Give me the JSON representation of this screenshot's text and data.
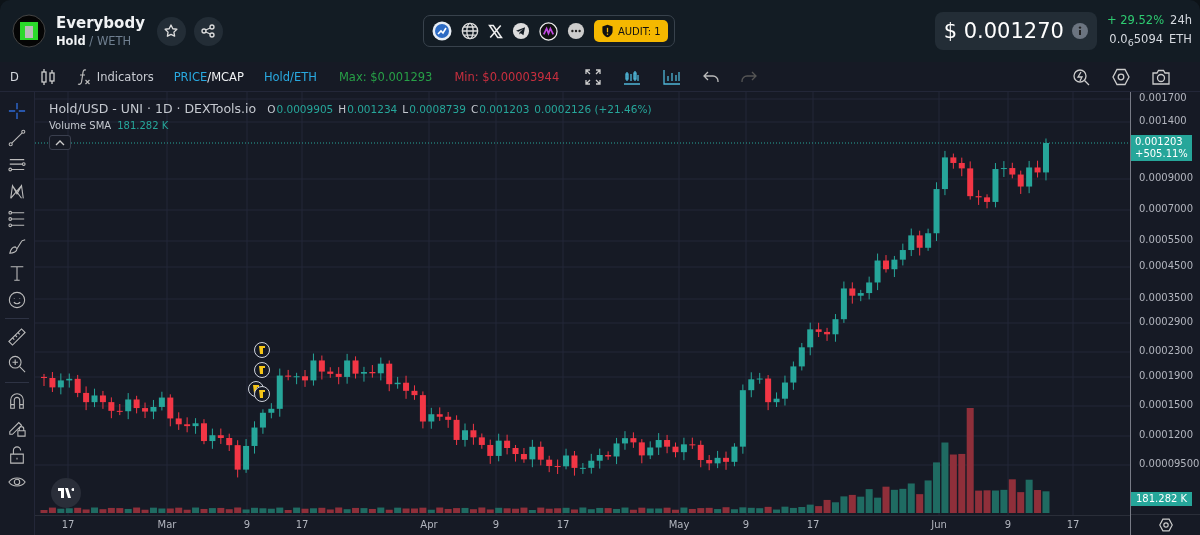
{
  "token": {
    "name": "Everybody",
    "base": "Hold",
    "quote": "/ WETH"
  },
  "audit": "AUDIT: 1",
  "price": {
    "value": "$ 0.001270",
    "change": "+ 29.52%",
    "period": "24h",
    "eth_value": "0.0$_{6}$5094",
    "eth_unit": "ETH"
  },
  "toolbar": {
    "interval": "D",
    "indicators": "Indicators",
    "modes": [
      {
        "label": "PRICE",
        "selected": true
      },
      {
        "label": "/MCAP",
        "selected": false
      }
    ],
    "pair": "Hold/ETH",
    "max": "Max: $0.001293",
    "min": "Min: $0.00003944"
  },
  "legend": {
    "title": "Hold/USD - UNI · 1D · DEXTools.io",
    "ohlc": [
      {
        "key": "O",
        "value": "0.0009905"
      },
      {
        "key": "H",
        "value": "0.001234"
      },
      {
        "key": "L",
        "value": "0.0008739"
      },
      {
        "key": "C",
        "value": "0.001203"
      }
    ],
    "change": "0.0002126 (+21.46%)",
    "volume_label": "Volume SMA",
    "volume_value": "181.282 K"
  },
  "price_axis": {
    "ticks": [
      "0.001700",
      "0.001400",
      "0.0009000",
      "0.0007000",
      "0.0005500",
      "0.0004500",
      "0.0003500",
      "0.0002900",
      "0.0002300",
      "0.0001900",
      "0.0001500",
      "0.0001200",
      "0.00009500"
    ],
    "last_price": "0.001203",
    "last_change": "+505.11%",
    "volume_badge": "181.282 K"
  },
  "time_axis": [
    "17",
    "Mar",
    "9",
    "17",
    "Apr",
    "9",
    "17",
    "May",
    "9",
    "17",
    "Jun",
    "9",
    "17"
  ]
}
